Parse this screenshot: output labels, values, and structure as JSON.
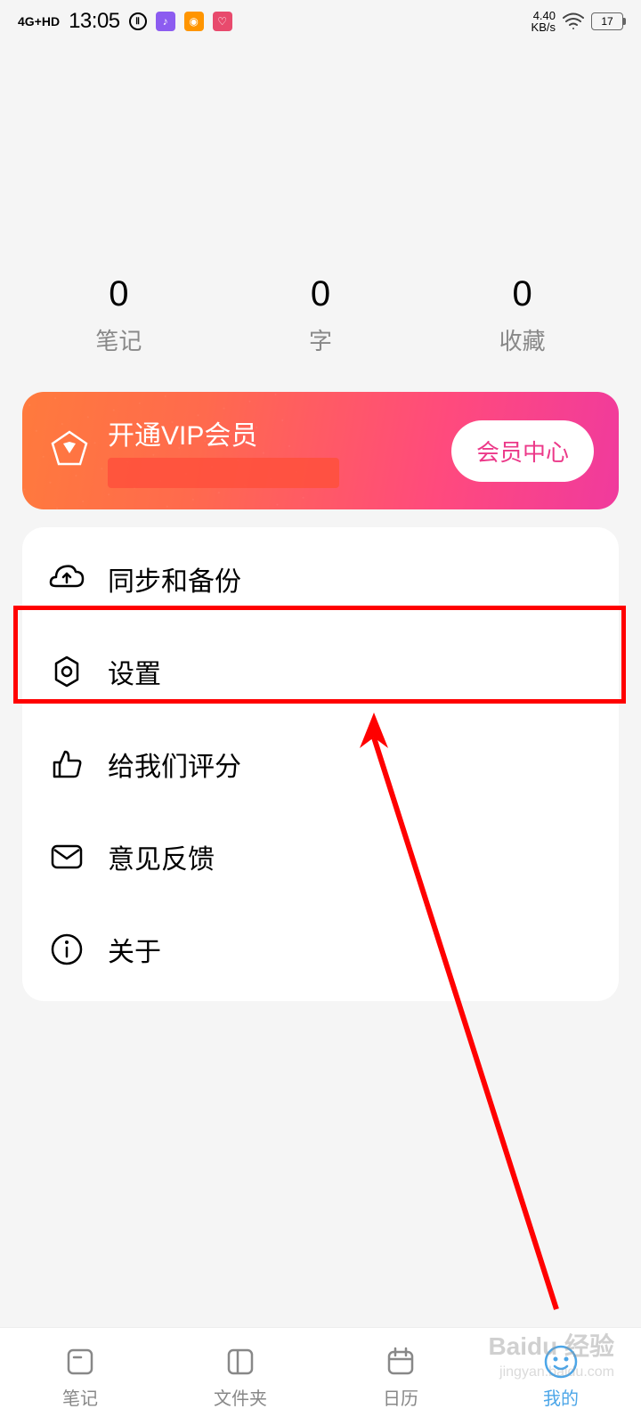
{
  "status_bar": {
    "signal": "4G+HD",
    "time": "13:05",
    "speed_value": "4.40",
    "speed_unit": "KB/s",
    "battery": "17"
  },
  "stats": {
    "notes": {
      "value": "0",
      "label": "笔记"
    },
    "words": {
      "value": "0",
      "label": "字"
    },
    "favorites": {
      "value": "0",
      "label": "收藏"
    }
  },
  "vip": {
    "title": "开通VIP会员",
    "button": "会员中心"
  },
  "menu": {
    "sync": "同步和备份",
    "settings": "设置",
    "rate": "给我们评分",
    "feedback": "意见反馈",
    "about": "关于"
  },
  "nav": {
    "notes": "笔记",
    "folders": "文件夹",
    "calendar": "日历",
    "mine": "我的"
  },
  "watermark": {
    "main": "Baidu 经验",
    "sub": "jingyan.baidu.com"
  }
}
